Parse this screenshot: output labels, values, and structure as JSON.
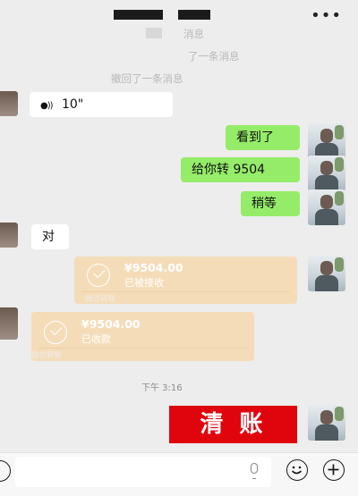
{
  "header": {
    "more_icon": "•••"
  },
  "system_messages": {
    "recall_1": "消息",
    "recall_2": "了一条消息",
    "recall_3": "撤回了一条消息"
  },
  "messages": {
    "voice_duration": "10\"",
    "saw_it": "看到了",
    "transfer_to_you": "给你转 9504",
    "wait": "稍等",
    "ok": "对"
  },
  "transfers": [
    {
      "amount": "¥9504.00",
      "status": "已被接收",
      "footer": "微信转账"
    },
    {
      "amount": "¥9504.00",
      "status": "已收款",
      "footer": "微信转账"
    }
  ],
  "time_label": "下午 3:16",
  "sticker_text": "清账",
  "bottom_bar": {
    "emoji_icon": "smiley-icon",
    "plus_icon": "plus-icon",
    "mic_icon": "microphone-icon"
  }
}
